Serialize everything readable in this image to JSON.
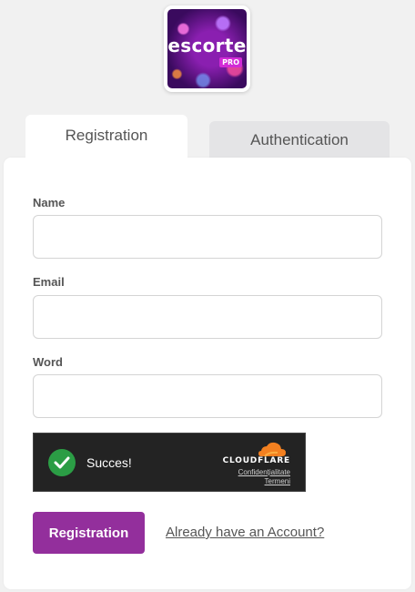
{
  "logo": {
    "text": "escorte",
    "badge": "PRO"
  },
  "tabs": [
    {
      "label": "Registration",
      "active": true
    },
    {
      "label": "Authentication",
      "active": false
    }
  ],
  "form": {
    "fields": [
      {
        "label": "Name",
        "value": "",
        "placeholder": ""
      },
      {
        "label": "Email",
        "value": "",
        "placeholder": ""
      },
      {
        "label": "Word",
        "value": "",
        "placeholder": ""
      }
    ],
    "captcha": {
      "status_text": "Succes!",
      "brand": "CLOUDFLARE",
      "privacy_link": "Confidențialitate",
      "terms_link": "Termeni"
    },
    "submit_label": "Registration",
    "login_link": "Already have an Account?"
  },
  "colors": {
    "accent": "#932f9c",
    "success": "#2b9d45",
    "cloudflare_orange": "#f38020"
  }
}
